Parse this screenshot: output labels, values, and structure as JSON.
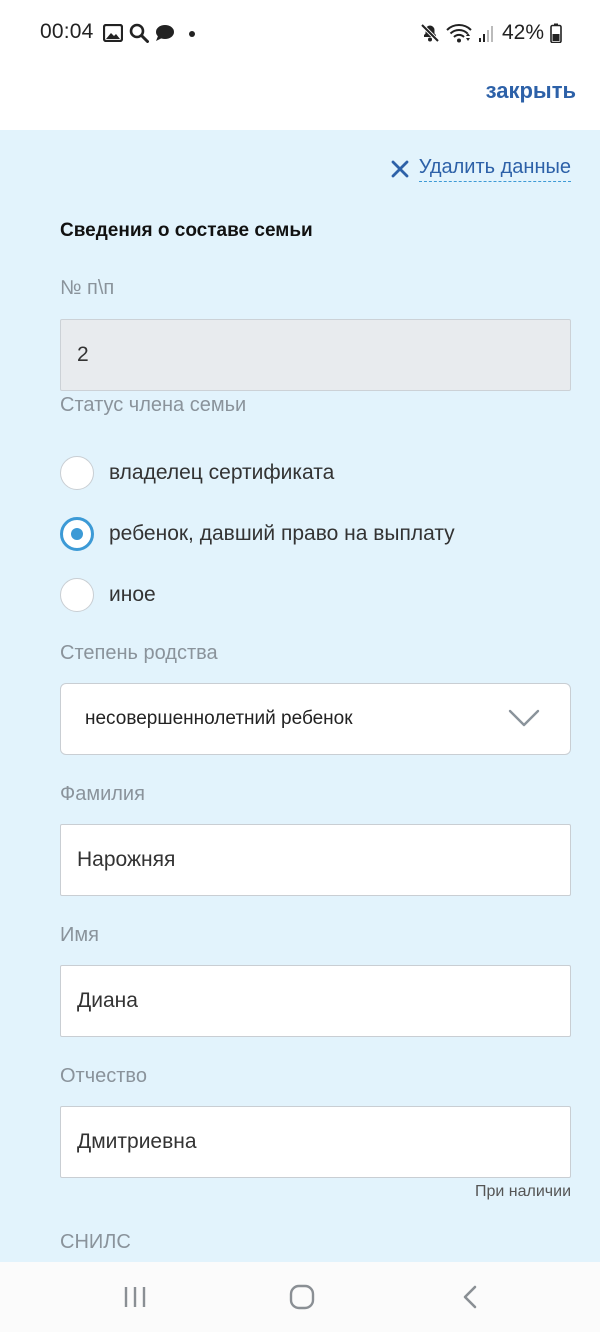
{
  "status_bar": {
    "time": "00:04",
    "left_icons": [
      "image-icon",
      "search-icon",
      "chat-icon",
      "dot-icon"
    ],
    "right_icons": [
      "mute-icon",
      "wifi-icon",
      "signal-icon",
      "battery-icon"
    ],
    "battery": "42%"
  },
  "header": {
    "close_label": "закрыть"
  },
  "form": {
    "delete_label": "Удалить данные",
    "section_title": "Сведения о составе семьи",
    "number": {
      "label": "№ п\\п",
      "value": "2"
    },
    "status": {
      "label": "Статус члена семьи",
      "options": [
        {
          "label": "владелец сертификата",
          "checked": false
        },
        {
          "label": "ребенок, давший право на выплату",
          "checked": true
        },
        {
          "label": "иное",
          "checked": false
        }
      ]
    },
    "relation": {
      "label": "Степень родства",
      "value": "несовершеннолетний ребенок"
    },
    "surname": {
      "label": "Фамилия",
      "value": "Нарожняя"
    },
    "name": {
      "label": "Имя",
      "value": "Диана"
    },
    "patronymic": {
      "label": "Отчество",
      "value": "Дмитриевна",
      "hint": "При наличии"
    },
    "snils": {
      "label": "СНИЛС"
    }
  },
  "nav_bar": {
    "buttons": [
      "recent-apps-icon",
      "home-icon",
      "back-icon"
    ]
  },
  "colors": {
    "accent": "#2d61a8",
    "radio": "#3c9ad6",
    "form_background": "#e2f3fc"
  }
}
